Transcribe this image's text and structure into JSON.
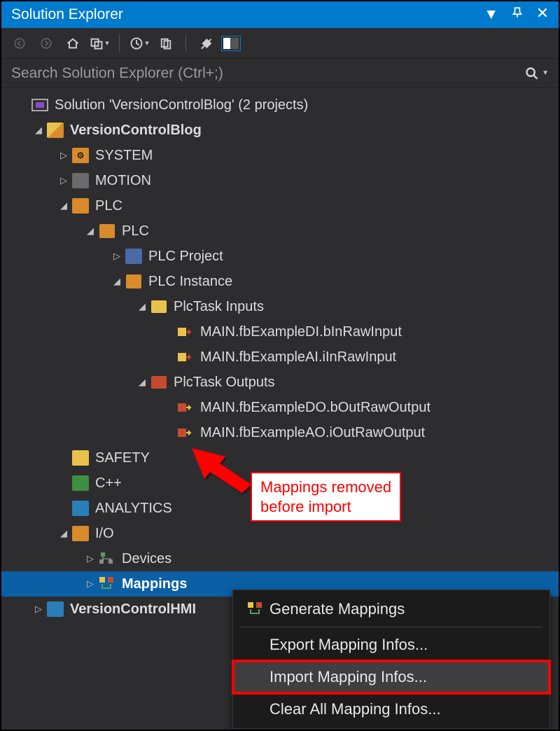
{
  "titlebar": {
    "title": "Solution Explorer"
  },
  "search": {
    "placeholder": "Search Solution Explorer (Ctrl+;)"
  },
  "tree": {
    "solution": "Solution 'VersionControlBlog' (2 projects)",
    "project1": "VersionControlBlog",
    "system": "SYSTEM",
    "motion": "MOTION",
    "plc": "PLC",
    "plc_inner": "PLC",
    "plc_project": "PLC Project",
    "plc_instance": "PLC Instance",
    "task_inputs": "PlcTask Inputs",
    "in1": "MAIN.fbExampleDI.bInRawInput",
    "in2": "MAIN.fbExampleAI.iInRawInput",
    "task_outputs": "PlcTask Outputs",
    "out1": "MAIN.fbExampleDO.bOutRawOutput",
    "out2": "MAIN.fbExampleAO.iOutRawOutput",
    "safety": "SAFETY",
    "cpp": "C++",
    "analytics": "ANALYTICS",
    "io": "I/O",
    "devices": "Devices",
    "mappings": "Mappings",
    "project2": "VersionControlHMI"
  },
  "context_menu": {
    "generate": "Generate Mappings",
    "export": "Export Mapping Infos...",
    "import": "Import Mapping Infos...",
    "clear": "Clear All Mapping Infos..."
  },
  "callout": {
    "line1": "Mappings removed",
    "line2": "before import"
  }
}
